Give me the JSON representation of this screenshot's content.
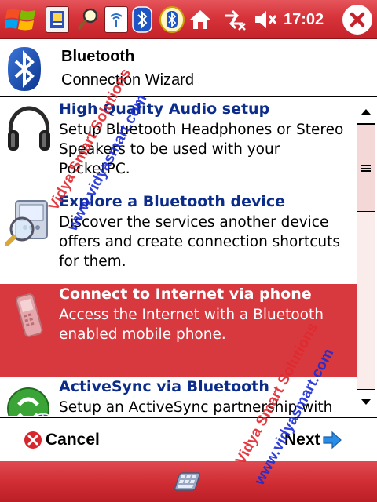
{
  "status_bar": {
    "icons": [
      "windows-start-icon",
      "contacts-app-icon",
      "search-app-icon",
      "signal-app-icon",
      "bluetooth-app-icon",
      "bluetooth-manager-icon",
      "home-icon",
      "connectivity-icon",
      "volume-muted-icon"
    ],
    "time": "17:02",
    "close_icon": "close-icon"
  },
  "header": {
    "title": "Bluetooth",
    "subtitle": "Connection Wizard",
    "icon": "bluetooth-logo-icon"
  },
  "list": {
    "items": [
      {
        "title": "High Quality Audio setup",
        "description": "Setup Bluetooth Headphones or Stereo Speakers to be used with your PocketPC.",
        "icon": "headphones-icon",
        "selected": false
      },
      {
        "title": "Explore a Bluetooth device",
        "description": "Discover the services another device offers and create connection shortcuts for them.",
        "icon": "explore-device-icon",
        "selected": false
      },
      {
        "title": "Connect to Internet via phone",
        "description": "Access the Internet with a Bluetooth enabled mobile phone.",
        "icon": "mobile-phone-icon",
        "selected": true
      },
      {
        "title": "ActiveSync via Bluetooth",
        "description": "Setup an ActiveSync partnership with",
        "icon": "activesync-icon",
        "selected": false
      }
    ]
  },
  "scrollbar": {
    "position_fraction": 0.0,
    "visible_fraction": 0.33
  },
  "footer": {
    "cancel_label": "Cancel",
    "next_label": "Next"
  },
  "menu_bar": {
    "sip_icon": "keyboard-input-icon"
  },
  "watermark": {
    "line1": "Vidya Smart Solutions",
    "line2": "www.vidyasmart.com"
  },
  "colors": {
    "theme_red": "#d7333a",
    "selection_red": "#d8393e",
    "title_blue": "#0b2c8a"
  }
}
